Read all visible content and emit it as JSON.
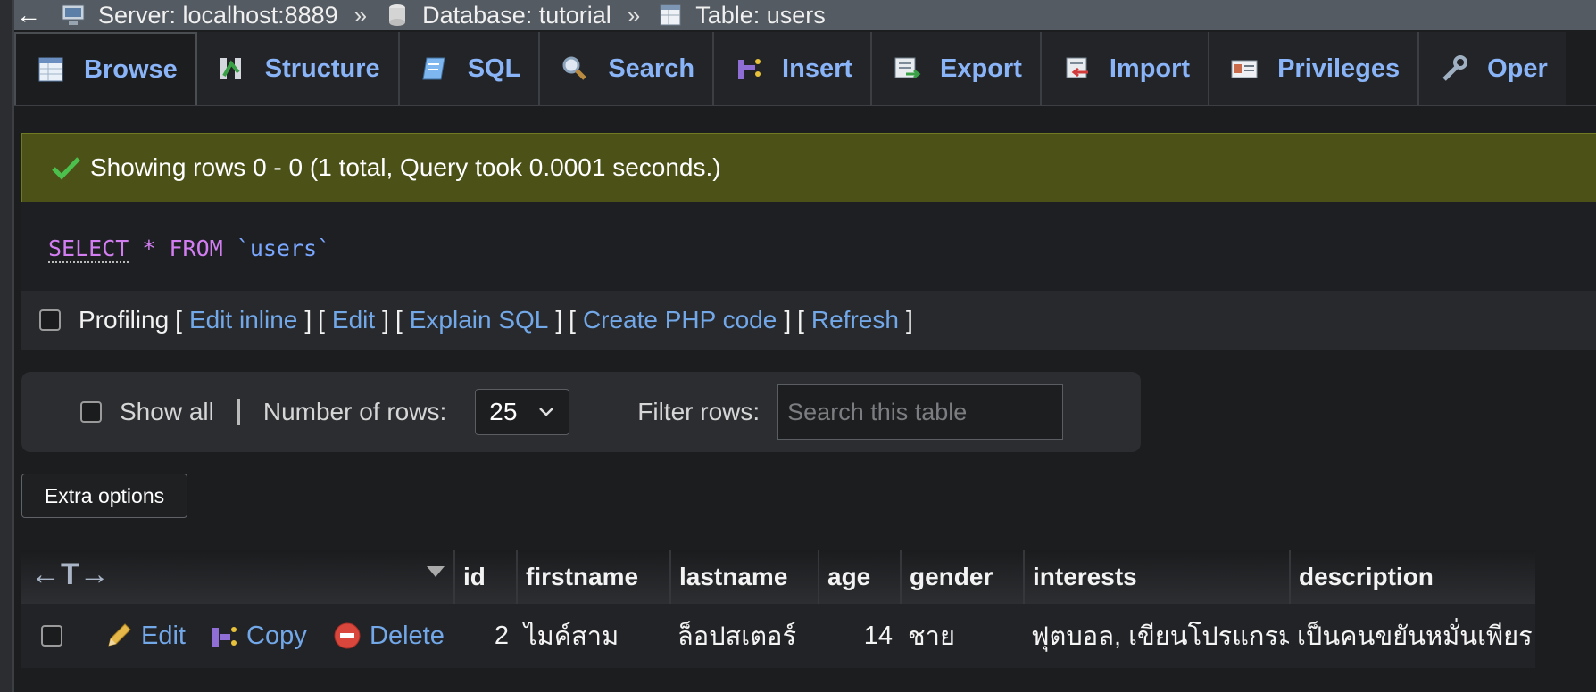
{
  "breadcrumb": {
    "back_label": "←",
    "server": "Server: localhost:8889",
    "database": "Database: tutorial",
    "table": "Table: users",
    "separator": "»"
  },
  "tabs": [
    {
      "label": "Browse",
      "icon": "browse-icon",
      "active": true
    },
    {
      "label": "Structure",
      "icon": "structure-icon"
    },
    {
      "label": "SQL",
      "icon": "sql-icon"
    },
    {
      "label": "Search",
      "icon": "search-icon"
    },
    {
      "label": "Insert",
      "icon": "insert-icon"
    },
    {
      "label": "Export",
      "icon": "export-icon"
    },
    {
      "label": "Import",
      "icon": "import-icon"
    },
    {
      "label": "Privileges",
      "icon": "privileges-icon"
    },
    {
      "label": "Oper",
      "icon": "operations-icon"
    }
  ],
  "message": {
    "text": "Showing rows 0 - 0 (1 total, Query took 0.0001 seconds.)",
    "color": "#4b5117"
  },
  "query": {
    "select": "SELECT",
    "star": "*",
    "from": "FROM",
    "table": "`users`"
  },
  "profiling": {
    "label": "Profiling",
    "links": [
      "Edit inline",
      "Edit",
      "Explain SQL",
      "Create PHP code",
      "Refresh"
    ],
    "open": "[",
    "close": "]"
  },
  "nav": {
    "show_all": "Show all",
    "rows_label": "Number of rows:",
    "rows_value": "25",
    "filter_label": "Filter rows:",
    "filter_placeholder": "Search this table"
  },
  "extra_options": "Extra options",
  "table": {
    "columns": [
      "id",
      "firstname",
      "lastname",
      "age",
      "gender",
      "interests",
      "description"
    ],
    "row": {
      "actions": {
        "edit": "Edit",
        "copy": "Copy",
        "delete": "Delete"
      },
      "id": "2",
      "firstname": "ไมค์สาม",
      "lastname": "ล็อปสเตอร์",
      "age": "14",
      "gender": "ชาย",
      "interests": "ฟุตบอล, เขียนโปรแกรม",
      "description": "เป็นคนขยันหมั่นเพียร"
    },
    "column_toggle_glyph": "←T→"
  },
  "colors": {
    "link": "#72a7e8",
    "tab_text": "#8ab4f8",
    "sql_keyword": "#d27ef2"
  }
}
